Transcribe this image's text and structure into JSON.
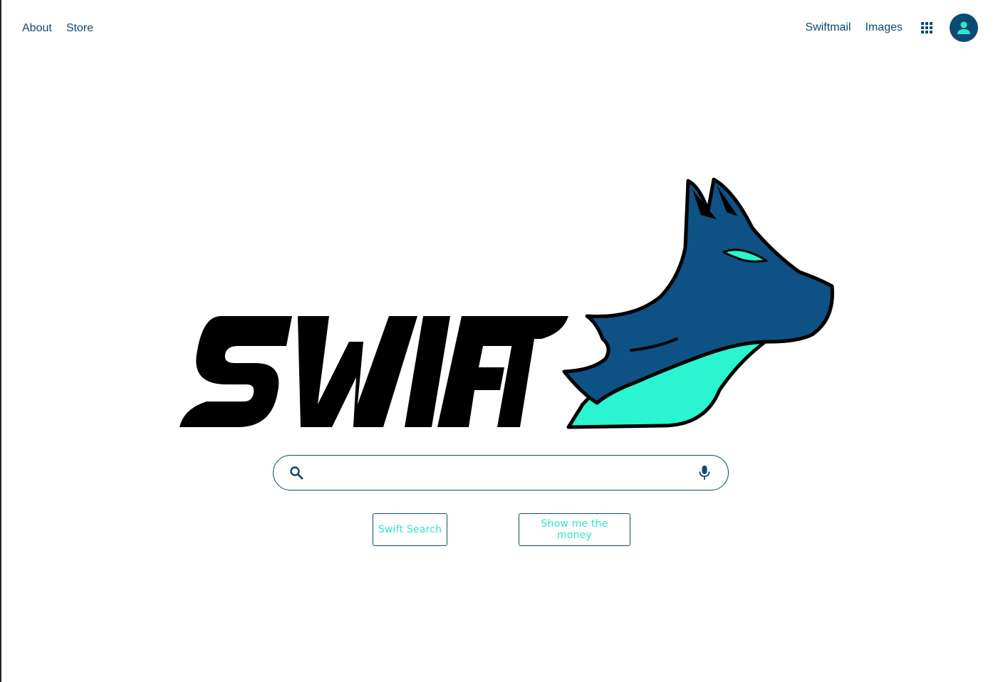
{
  "nav": {
    "left_links": [
      "About",
      "Store"
    ],
    "right_links": [
      "Swiftmail",
      "Images"
    ],
    "apps_icon": "apps-grid-icon",
    "avatar_icon": "user-avatar-icon"
  },
  "logo": {
    "wordmark": "SWIFT",
    "mascot": "wolf-head"
  },
  "search": {
    "value": "",
    "placeholder": "",
    "search_icon": "search-icon",
    "mic_icon": "microphone-icon"
  },
  "buttons": {
    "search_label": "Swift Search",
    "lucky_label": "Show me the money"
  },
  "colors": {
    "brand_navy": "#0d4a73",
    "accent_teal": "#2ee6cc",
    "wordmark_black": "#000000",
    "background": "#ffffff"
  }
}
